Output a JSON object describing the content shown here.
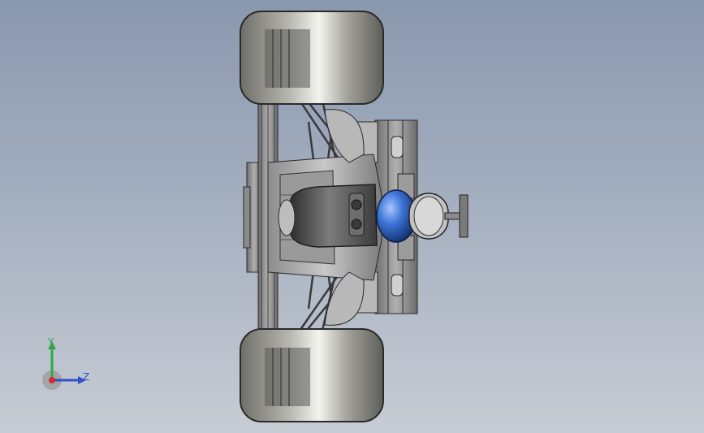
{
  "viewport": {
    "background_top": "#8a98ae",
    "background_bottom": "#c7ccd4"
  },
  "model": {
    "icon": "race-car-top-view",
    "body_color": "#a7a7a7",
    "tire_color": "#8c8c84",
    "helmet_color": "#3d73d6"
  },
  "triad": {
    "y_label": "Y",
    "z_label": "Z",
    "y_color": "#33a64a",
    "z_color": "#2d52c9",
    "x_color": "#d62d2d"
  }
}
